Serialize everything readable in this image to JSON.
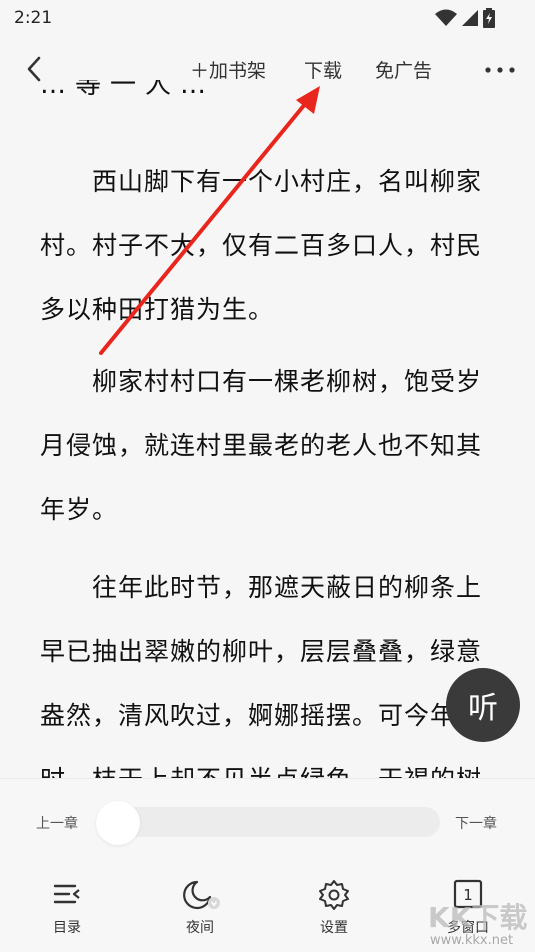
{
  "status_bar": {
    "time": "2:21"
  },
  "toolbar": {
    "add_shelf_label": "＋加书架",
    "download_label": "下载",
    "no_ads_label": "免广告"
  },
  "reading": {
    "cut_line": "…等一人…",
    "paragraphs": [
      "西山脚下有一个小村庄，名叫柳家村。村子不大，仅有二百多口人，村民多以种田打猎为生。",
      "柳家村村口有一棵老柳树，饱受岁月侵蚀，就连村里最老的老人也不知其年岁。",
      "往年此时节，那遮天蔽日的柳条上早已抽出翠嫩的柳叶，层层叠叠，绿意盎然，清风吹过，婀娜摇摆。可今年此时，枝干上却不见半点绿色。干褐的树"
    ]
  },
  "listen_label": "听",
  "chapter_nav": {
    "prev_label": "上一章",
    "next_label": "下一章",
    "progress": 0
  },
  "bottom_nav": [
    {
      "label": "目录",
      "icon": "toc-icon"
    },
    {
      "label": "夜间",
      "icon": "night-mode-icon"
    },
    {
      "label": "设置",
      "icon": "settings-gear-icon"
    },
    {
      "label": "多窗口",
      "icon": "multi-window-icon",
      "count": "1"
    }
  ],
  "watermark": {
    "logo": "KK下载",
    "url": "www.kkx.net"
  },
  "colors": {
    "annotation_arrow": "#e8261e",
    "listen_button": "#3a3a3a",
    "background": "#f6f6f6"
  }
}
